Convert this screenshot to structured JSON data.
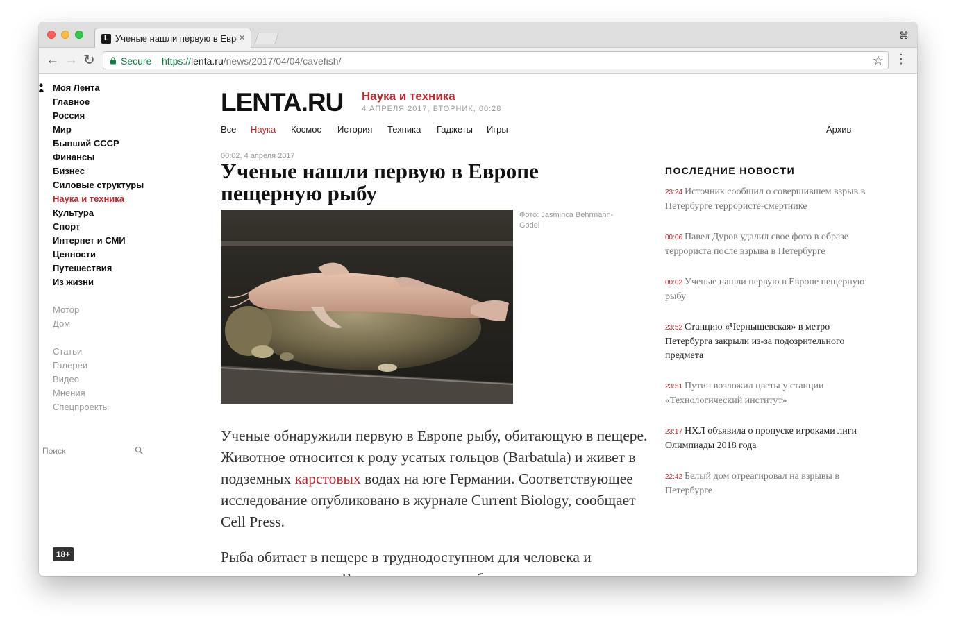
{
  "browser": {
    "tab_title": "Ученые нашли первую в Европе пещерную рыбу",
    "tab_favicon": "L",
    "tab_close": "×",
    "cmd_symbol": "⌘",
    "secure_label": "Secure",
    "url_scheme": "https://",
    "url_host": "lenta.ru",
    "url_path": "/news/2017/04/04/cavefish/",
    "icons": [
      "back-arrow-icon",
      "forward-arrow-icon",
      "reload-icon",
      "lock-icon",
      "star-icon",
      "menu-icon"
    ]
  },
  "site": {
    "logo": "LENTA.RU",
    "section": "Наука и техника",
    "dateline": "4 АПРЕЛЯ 2017, ВТОРНИК, 00:28",
    "accent_color": "#c0282d"
  },
  "sidebar": {
    "main": [
      "Моя Лента",
      "Главное",
      "Россия",
      "Мир",
      "Бывший СССР",
      "Финансы",
      "Бизнес",
      "Силовые структуры",
      "Наука и техника",
      "Культура",
      "Спорт",
      "Интернет и СМИ",
      "Ценности",
      "Путешествия",
      "Из жизни"
    ],
    "extra": [
      "Мотор",
      "Дом"
    ],
    "media": [
      "Статьи",
      "Галереи",
      "Видео",
      "Мнения",
      "Спецпроекты"
    ],
    "search_placeholder": "Поиск",
    "age_badge": "18+"
  },
  "topnav": {
    "items": [
      "Все",
      "Наука",
      "Космос",
      "История",
      "Техника",
      "Гаджеты",
      "Игры"
    ],
    "archive": "Архив"
  },
  "article": {
    "time": "00:02, 4 апреля 2017",
    "title": "Ученые нашли первую в Европе пещерную рыбу",
    "photo_credit": "Фото: Jasminca Behrmann-Godel",
    "p1_before": "Ученые обнаружили первую в Европе рыбу, обитающую в пещере. Животное относится к роду усатых гольцов (Barbatula) и живет в подземных ",
    "p1_link": "карстовых",
    "p1_after": " водах на юге Германии. Соответствующее исследование опубликовано в журнале Current Biology, сообщает Cell Press.",
    "p2": "Рыба обитает в пещере в труднодоступном для человека и животных водоем. Возраст карстового образования, где"
  },
  "latest_news": {
    "heading": "ПОСЛЕДНИЕ НОВОСТИ",
    "items": [
      {
        "time": "23:24",
        "text": "Источник сообщил о совершившем взрыв в Петербурге террористе-смертнике"
      },
      {
        "time": "00:06",
        "text": "Павел Дуров удалил свое фото в образе террориста после взрыва в Петербурге"
      },
      {
        "time": "00:02",
        "text": "Ученые нашли первую в Европе пещерную рыбу"
      },
      {
        "time": "23:52",
        "text": "Станцию «Чернышевская» в метро Петербурга закрыли из-за подозрительного предмета"
      },
      {
        "time": "23:51",
        "text": "Путин возложил цветы у станции «Технологический институт»"
      },
      {
        "time": "23:17",
        "text": "НХЛ объявила о пропуске игроками лиги Олимпиады 2018 года"
      },
      {
        "time": "22:42",
        "text": "Белый дом отреагировал на взрывы в Петербурге"
      }
    ]
  }
}
